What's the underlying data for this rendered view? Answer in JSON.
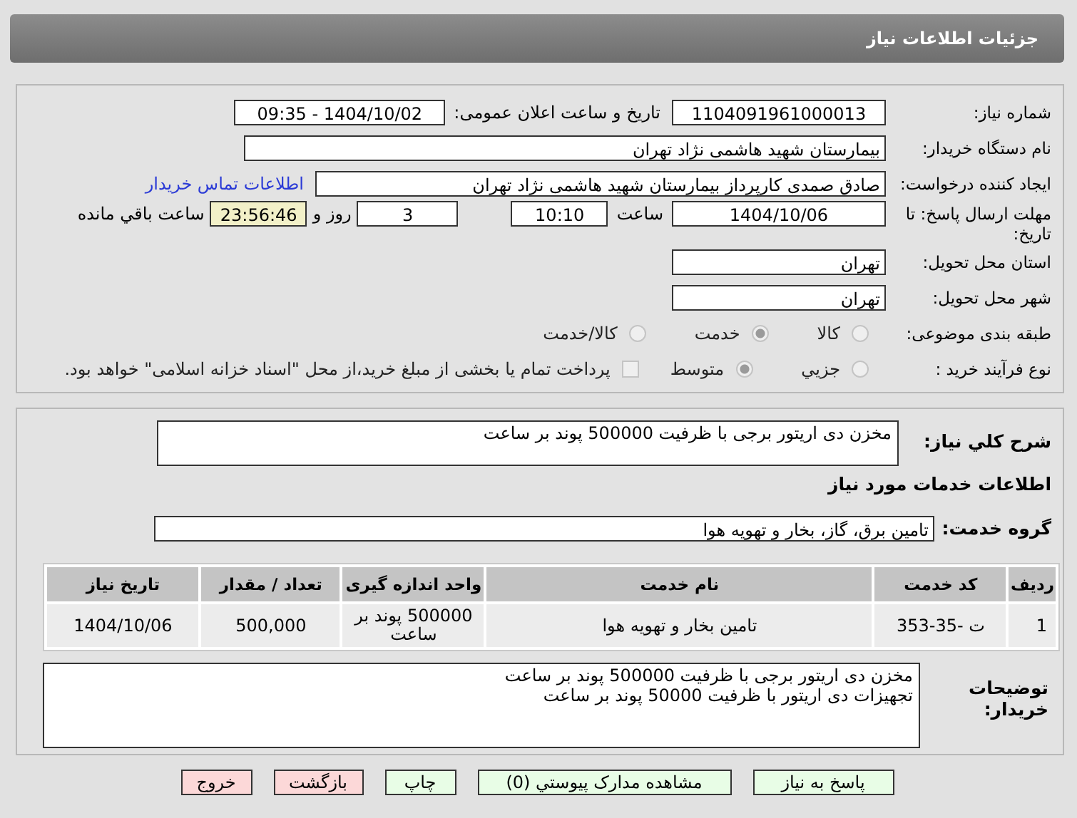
{
  "header": {
    "title": "جزئیات اطلاعات نیاز"
  },
  "details": {
    "need_number": {
      "label": "شماره نیاز:",
      "value": "1104091961000013"
    },
    "announce": {
      "label": "تاریخ و ساعت اعلان عمومی:",
      "value": "1404/10/02 - 09:35"
    },
    "buyer_org": {
      "label": "نام دستگاه خریدار:",
      "value": "بیمارستان شهید هاشمی نژاد تهران"
    },
    "requester": {
      "label": "ایجاد کننده درخواست:",
      "value": "صادق صمدی کارپرداز بیمارستان شهید هاشمی نژاد تهران",
      "link": "اطلاعات تماس خریدار"
    },
    "deadline": {
      "label": "مهلت ارسال پاسخ: تا تاریخ:",
      "date": "1404/10/06",
      "time_label": "ساعت",
      "time": "10:10",
      "days": "3",
      "days_label": "روز و",
      "remaining": "23:56:46",
      "remaining_label": "ساعت باقي مانده"
    },
    "province": {
      "label": "استان محل تحویل:",
      "value": "تهران"
    },
    "city": {
      "label": "شهر محل تحویل:",
      "value": "تهران"
    },
    "category": {
      "label": "طبقه بندی موضوعی:",
      "options": [
        {
          "label": "کالا",
          "selected": false
        },
        {
          "label": "خدمت",
          "selected": true
        },
        {
          "label": "کالا/خدمت",
          "selected": false
        }
      ]
    },
    "process": {
      "label": "نوع فرآیند خرید :",
      "options": [
        {
          "label": "جزیي",
          "selected": false
        },
        {
          "label": "متوسط",
          "selected": true
        }
      ],
      "payment": {
        "checked": false,
        "label": "پرداخت تمام یا بخشی از مبلغ خرید،از محل \"اسناد خزانه اسلامی\" خواهد بود."
      }
    }
  },
  "summary": {
    "label": "شرح کلي نیاز:",
    "value": "مخزن دی اریتور برجی با ظرفیت 500000 پوند بر ساعت"
  },
  "services_title": "اطلاعات خدمات مورد نیاز",
  "service_group": {
    "label": "گروه خدمت:",
    "value": "تامین برق، گاز، بخار و تهویه هوا"
  },
  "table": {
    "columns": [
      "ردیف",
      "کد خدمت",
      "نام خدمت",
      "واحد اندازه گیری",
      "تعداد / مقدار",
      "تاریخ نیاز"
    ],
    "rows": [
      [
        "1",
        "ت -35-353",
        "تامین بخار و تهویه هوا",
        "500000 پوند بر ساعت",
        "500,000",
        "1404/10/06"
      ]
    ]
  },
  "buyer_notes": {
    "label": "توضیحات خریدار:",
    "lines": [
      "مخزن دی اریتور برجی با ظرفیت 500000 پوند بر ساعت",
      "تجهیزات دی اریتور با ظرفیت 50000 پوند بر ساعت"
    ]
  },
  "buttons": [
    {
      "label": "پاسخ به نیاز",
      "kind": "green"
    },
    {
      "label": "مشاهده مدارک پیوستي (0)",
      "kind": "green"
    },
    {
      "label": "چاپ",
      "kind": "green"
    },
    {
      "label": "بازگشت",
      "kind": "red"
    },
    {
      "label": "خروج",
      "kind": "red"
    }
  ]
}
